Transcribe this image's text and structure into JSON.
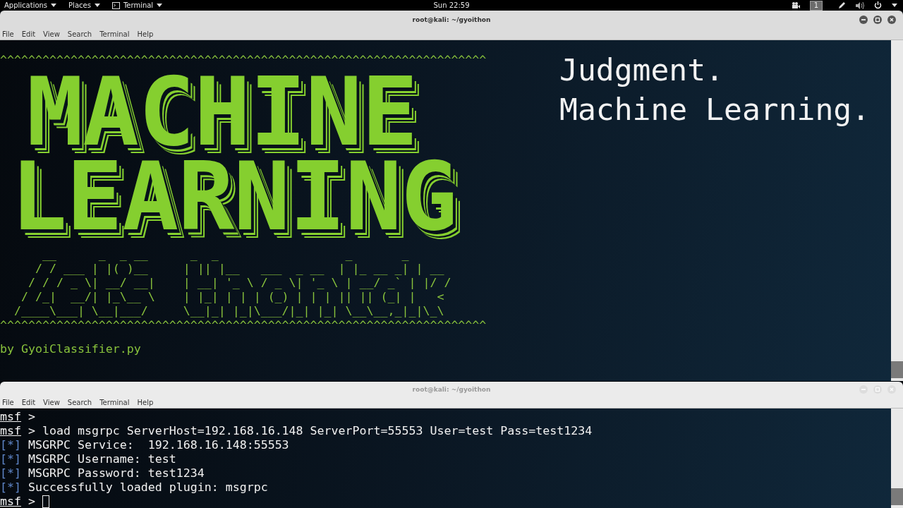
{
  "top_panel": {
    "menus": [
      "Applications",
      "Places",
      "Terminal"
    ],
    "clock": "Sun 22:59",
    "workspace": "1"
  },
  "windows": [
    {
      "title": "root@kali: ~/gyoithon",
      "active": true,
      "menu": [
        "File",
        "Edit",
        "View",
        "Search",
        "Terminal",
        "Help"
      ],
      "banner": {
        "rule_top": "^^^^^^^^^^^^^^^^^^^^^^^^^^^^^^^^^^^^^^^^^^^^^^^^^^^^^^^^^^^^^^^^^^^^^",
        "big_words": [
          "MACHINE",
          "LEARNING"
        ],
        "ascii_lines": [
          "      __      _  _ __      _  _                  _       _",
          "     / / ___ | |( )__     | || |__   ___  _ __  | |_ __ _| | __",
          "    / / / _ \\| __/ __|    | __| '_ \\ / _ \\| '_ \\ | __/ _` | |/ /",
          "   / /_|  __/| |_\\__ \\    | |_| | | | (_) | | | || || (_| |   <",
          "  /____\\___| \\__|___/     \\__|_| |_|\\___/|_| |_| \\__\\__,_|_|\\_\\"
        ],
        "rule_bottom": "^^^^^^^^^^^^^^^^^^^^^^^^^^^^^^^^^^^^^^^^^^^^^^^^^^^^^^^^^^^^^^^^^^^^^",
        "byline": "by GyoiClassifier.py"
      },
      "side_text": [
        "Judgment.",
        "Machine Learning."
      ]
    },
    {
      "title": "root@kali: ~/gyoithon",
      "active": false,
      "menu": [
        "File",
        "Edit",
        "View",
        "Search",
        "Terminal",
        "Help"
      ],
      "lines": [
        {
          "kind": "prompt",
          "prompt": "msf",
          "text": " >"
        },
        {
          "kind": "prompt",
          "prompt": "msf",
          "text": " > load msgrpc ServerHost=192.168.16.148 ServerPort=55553 User=test Pass=test1234"
        },
        {
          "kind": "info",
          "prompt": "[*]",
          "text": " MSGRPC Service:  192.168.16.148:55553"
        },
        {
          "kind": "info",
          "prompt": "[*]",
          "text": " MSGRPC Username: test"
        },
        {
          "kind": "info",
          "prompt": "[*]",
          "text": " MSGRPC Password: test1234"
        },
        {
          "kind": "info",
          "prompt": "[*]",
          "text": " Successfully loaded plugin: msgrpc"
        },
        {
          "kind": "prompt",
          "prompt": "msf",
          "text": " >",
          "cursor": true
        }
      ]
    }
  ]
}
